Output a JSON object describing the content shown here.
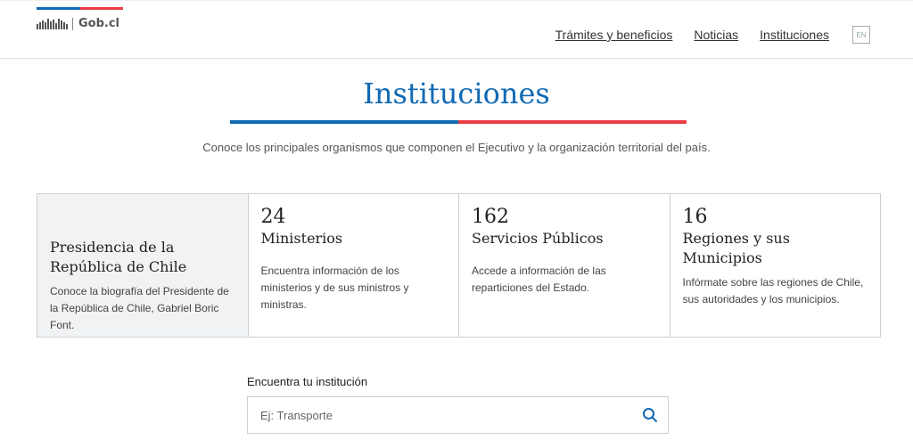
{
  "header": {
    "logo_text": "Gob.cl",
    "nav": [
      {
        "label": "Trámites y beneficios"
      },
      {
        "label": "Noticias"
      },
      {
        "label": "Instituciones"
      }
    ],
    "lang_label": "EN"
  },
  "main": {
    "title": "Instituciones",
    "subtitle": "Conoce los principales organismos que componen el Ejecutivo y la organización territorial del país.",
    "cards": [
      {
        "number": "",
        "title": "Presidencia de la República de Chile",
        "description": "Conoce la biografía del Presidente de la República de Chile, Gabriel Boric Font."
      },
      {
        "number": "24",
        "title": "Ministerios",
        "description": "Encuentra información de los ministerios y de sus ministros y ministras."
      },
      {
        "number": "162",
        "title": "Servicios Públicos",
        "description": "Accede a información de las reparticiones del Estado."
      },
      {
        "number": "16",
        "title": "Regiones y sus Municipios",
        "description": "Infórmate sobre las regiones de Chile, sus autoridades y los municipios."
      }
    ]
  },
  "search": {
    "label": "Encuentra tu institución",
    "placeholder": "Ej: Transporte",
    "value": ""
  },
  "colors": {
    "brand_blue": "#0f69b4",
    "brand_red": "#eb3c46"
  },
  "icons": {
    "search": "search-icon",
    "logo": "gob-logo-icon"
  }
}
